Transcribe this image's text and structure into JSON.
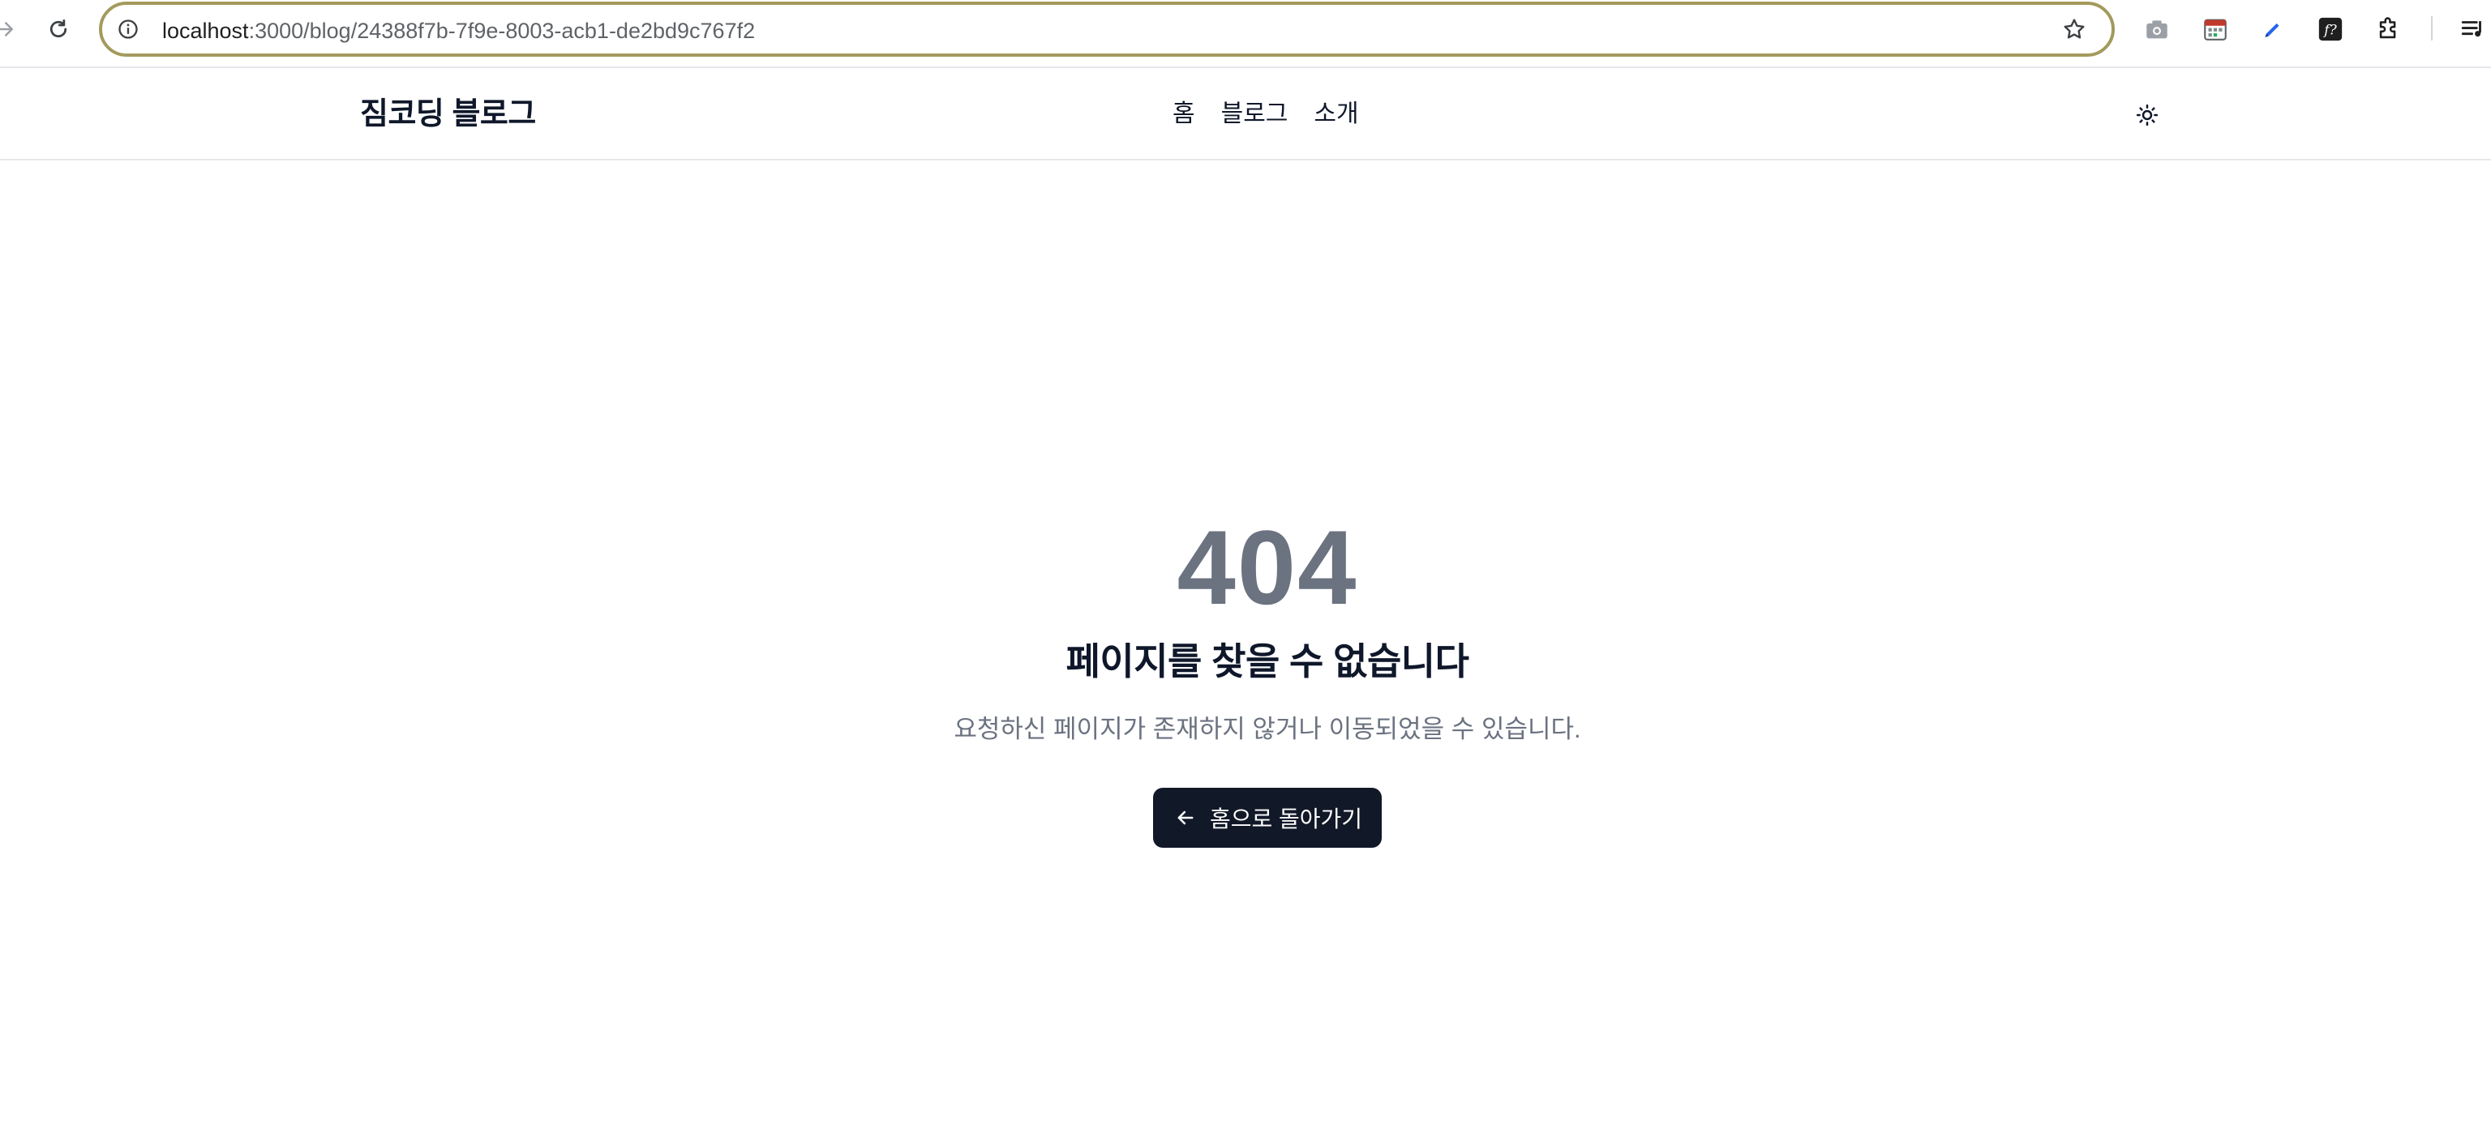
{
  "browser": {
    "url_host": "localhost",
    "url_path": ":3000/blog/24388f7b-7f9e-8003-acb1-de2bd9c767f2",
    "icons": [
      "forward-icon",
      "reload-icon",
      "info-icon",
      "star-icon",
      "camera-icon",
      "calendar-icon",
      "pen-icon",
      "fx-icon",
      "puzzle-icon",
      "queue-icon"
    ]
  },
  "header": {
    "brand": "짐코딩 블로그",
    "nav": [
      {
        "label": "홈"
      },
      {
        "label": "블로그"
      },
      {
        "label": "소개"
      }
    ],
    "theme_toggle_icon": "sun-icon"
  },
  "error": {
    "code": "404",
    "title": "페이지를 찾을 수 없습니다",
    "description": "요청하신 페이지가 존재하지 않거나 이동되었을 수 있습니다.",
    "button_label": "홈으로 돌아가기",
    "button_icon": "arrow-left-icon"
  },
  "colors": {
    "code_gray": "#6b7280",
    "button_bg": "#111827",
    "omnibox_border": "#a39a5c"
  }
}
